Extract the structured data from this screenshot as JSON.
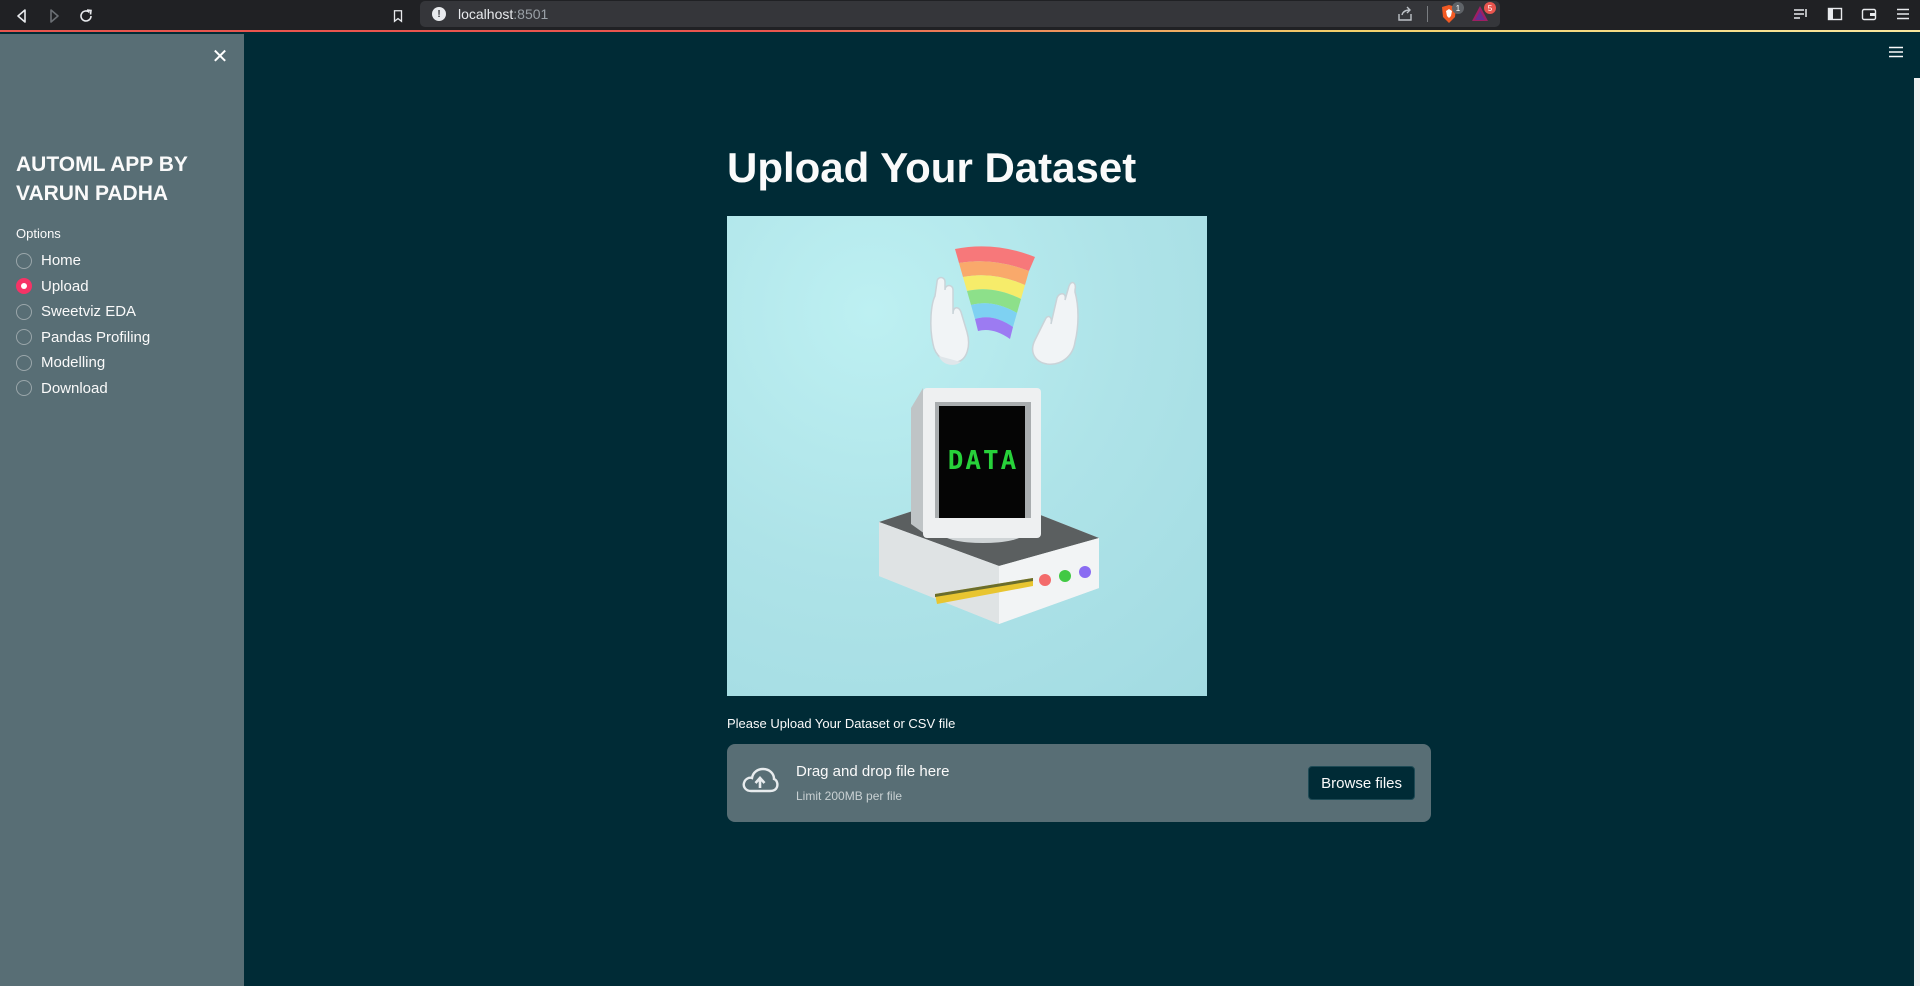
{
  "browser": {
    "url_host": "localhost",
    "url_port": ":8501",
    "shield_count": "1",
    "rewards_count": "5"
  },
  "sidebar": {
    "close_icon": "close-icon",
    "app_title": "AUTOML APP BY VARUN PADHA",
    "options_label": "Options",
    "selected": "Upload",
    "items": [
      {
        "label": "Home",
        "checked": false
      },
      {
        "label": "Upload",
        "checked": true
      },
      {
        "label": "Sweetviz EDA",
        "checked": false
      },
      {
        "label": "Pandas Profiling",
        "checked": false
      },
      {
        "label": "Modelling",
        "checked": false
      },
      {
        "label": "Download",
        "checked": false
      }
    ]
  },
  "main": {
    "title": "Upload Your Dataset",
    "image_screen_text": "DATA",
    "uploader": {
      "label": "Please Upload Your Dataset or CSV file",
      "drop_text": "Drag and drop file here",
      "limit_text": "Limit 200MB per file",
      "browse_label": "Browse files"
    }
  },
  "colors": {
    "app_bg": "#002b36",
    "sidebar_bg": "#586e75",
    "accent": "#f63366",
    "text": "#fafafa"
  }
}
